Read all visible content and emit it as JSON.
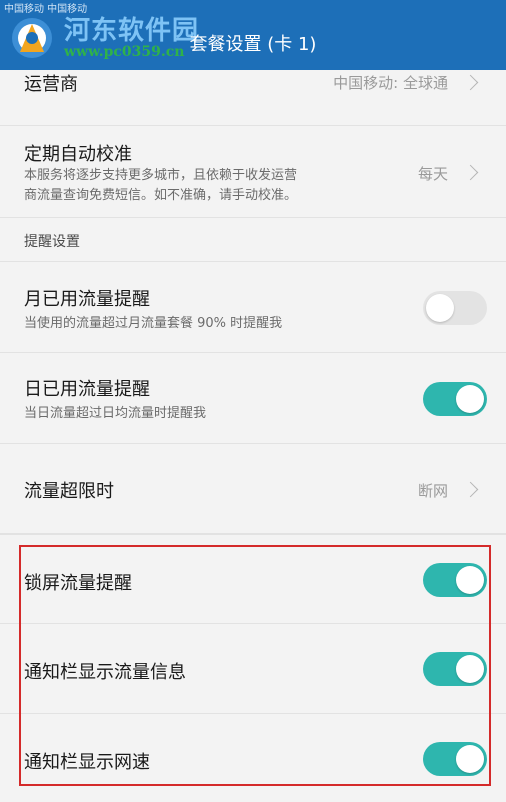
{
  "header": {
    "status_text": "中国移动 中国移动",
    "title": "套餐设置 (卡 1)",
    "watermark_name": "河东软件园",
    "watermark_url": "www.pc0359.cn"
  },
  "rows": {
    "carrier": {
      "label": "运营商",
      "value": "中国移动: 全球通"
    },
    "auto_calibrate": {
      "label": "定期自动校准",
      "desc_line1": "本服务将逐步支持更多城市，且依赖于收发运营",
      "desc_line2": "商流量查询免费短信。如不准确，请手动校准。",
      "value": "每天"
    },
    "reminder_section": {
      "label": "提醒设置"
    },
    "monthly_reminder": {
      "label": "月已用流量提醒",
      "desc": "当使用的流量超过月流量套餐 90% 时提醒我",
      "enabled": false
    },
    "daily_reminder": {
      "label": "日已用流量提醒",
      "desc": "当日流量超过日均流量时提醒我",
      "enabled": true
    },
    "over_limit": {
      "label": "流量超限时",
      "value": "断网"
    },
    "lockscreen_reminder": {
      "label": "锁屏流量提醒",
      "enabled": true
    },
    "notify_traffic": {
      "label": "通知栏显示流量信息",
      "enabled": true
    },
    "notify_speed": {
      "label": "通知栏显示网速",
      "enabled": true
    }
  },
  "colors": {
    "header_bg": "#1d6fb8",
    "toggle_on": "#2eb6ae",
    "toggle_off": "#e3e3e3",
    "highlight_border": "#d42a2a"
  },
  "icons": {
    "chevron": "chevron-right-icon"
  }
}
